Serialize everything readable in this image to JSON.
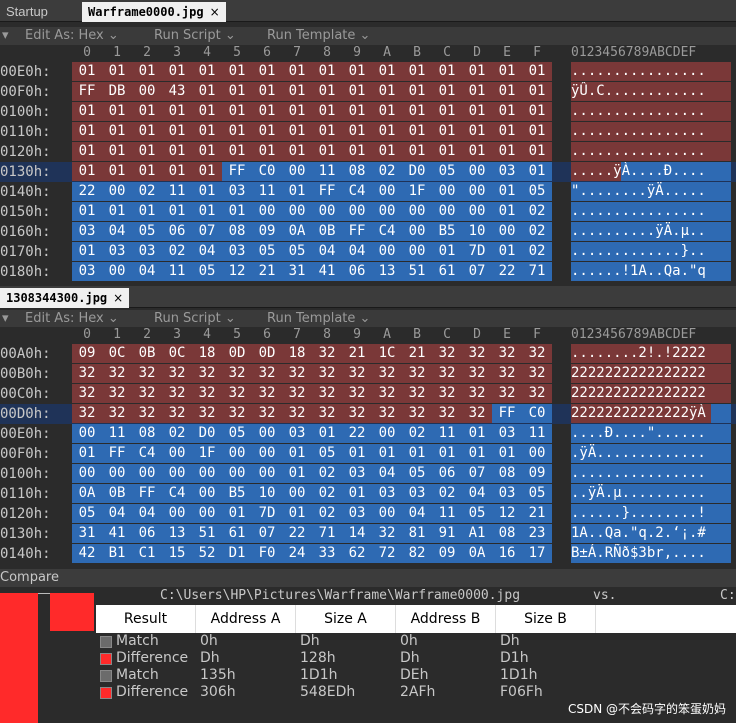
{
  "tabs1": {
    "startup": "Startup",
    "active": "Warframe0000.jpg",
    "close": "×"
  },
  "tabs2": {
    "active": "1308344300.jpg",
    "close": "×"
  },
  "toolbar": {
    "edit_as": "Edit As: Hex",
    "run_script": "Run Script",
    "run_template": "Run Template",
    "chevron": "⌄",
    "triangle": "▾"
  },
  "col_headers": [
    "0",
    "1",
    "2",
    "3",
    "4",
    "5",
    "6",
    "7",
    "8",
    "9",
    "A",
    "B",
    "C",
    "D",
    "E",
    "F"
  ],
  "ascii_header": "0123456789ABCDEF",
  "pane1": {
    "rows": [
      {
        "addr": "00E0h:",
        "bytes": "01 01 01 01 01 01 01 01 01 01 01 01 01 01 01 01",
        "ascii": "................",
        "marks": "dddddddddddddddd"
      },
      {
        "addr": "00F0h:",
        "bytes": "FF DB 00 43 01 01 01 01 01 01 01 01 01 01 01 01",
        "ascii": "ÿÛ.C............",
        "marks": "dddddddddddddddd"
      },
      {
        "addr": "0100h:",
        "bytes": "01 01 01 01 01 01 01 01 01 01 01 01 01 01 01 01",
        "ascii": "................",
        "marks": "dddddddddddddddd"
      },
      {
        "addr": "0110h:",
        "bytes": "01 01 01 01 01 01 01 01 01 01 01 01 01 01 01 01",
        "ascii": "................",
        "marks": "dddddddddddddddd"
      },
      {
        "addr": "0120h:",
        "bytes": "01 01 01 01 01 01 01 01 01 01 01 01 01 01 01 01",
        "ascii": "................",
        "marks": "dddddddddddddddd"
      },
      {
        "addr": "0130h:",
        "bytes": "01 01 01 01 01 FF C0 00 11 08 02 D0 05 00 03 01",
        "ascii": ".....ÿÀ....Ð....",
        "marks": "dddddmmmmmmmmmmm"
      },
      {
        "addr": "0140h:",
        "bytes": "22 00 02 11 01 03 11 01 FF C4 00 1F 00 00 01 05",
        "ascii": "\"........ÿÄ.....",
        "marks": "mmmmmmmmmmmmmmmm"
      },
      {
        "addr": "0150h:",
        "bytes": "01 01 01 01 01 01 00 00 00 00 00 00 00 00 01 02",
        "ascii": "................",
        "marks": "mmmmmmmmmmmmmmmm"
      },
      {
        "addr": "0160h:",
        "bytes": "03 04 05 06 07 08 09 0A 0B FF C4 00 B5 10 00 02",
        "ascii": "..........ÿÄ.µ..",
        "marks": "mmmmmmmmmmmmmmmm"
      },
      {
        "addr": "0170h:",
        "bytes": "01 03 03 02 04 03 05 05 04 04 00 00 01 7D 01 02",
        "ascii": ".............}..",
        "marks": "mmmmmmmmmmmmmmmm"
      },
      {
        "addr": "0180h:",
        "bytes": "03 00 04 11 05 12 21 31 41 06 13 51 61 07 22 71",
        "ascii": "......!1A..Qa.\"q",
        "marks": "mmmmmmmmmmmmmmmm"
      }
    ]
  },
  "pane2": {
    "rows": [
      {
        "addr": "00A0h:",
        "bytes": "09 0C 0B 0C 18 0D 0D 18 32 21 1C 21 32 32 32 32",
        "ascii": "........2!.!2222",
        "marks": "dddddddddddddddd"
      },
      {
        "addr": "00B0h:",
        "bytes": "32 32 32 32 32 32 32 32 32 32 32 32 32 32 32 32",
        "ascii": "2222222222222222",
        "marks": "dddddddddddddddd"
      },
      {
        "addr": "00C0h:",
        "bytes": "32 32 32 32 32 32 32 32 32 32 32 32 32 32 32 32",
        "ascii": "2222222222222222",
        "marks": "dddddddddddddddd"
      },
      {
        "addr": "00D0h:",
        "bytes": "32 32 32 32 32 32 32 32 32 32 32 32 32 32 FF C0",
        "ascii": "22222222222222ÿÀ",
        "marks": "ddddddddddddddmm"
      },
      {
        "addr": "00E0h:",
        "bytes": "00 11 08 02 D0 05 00 03 01 22 00 02 11 01 03 11",
        "ascii": "....Ð....\"......",
        "marks": "mmmmmmmmmmmmmmmm"
      },
      {
        "addr": "00F0h:",
        "bytes": "01 FF C4 00 1F 00 00 01 05 01 01 01 01 01 01 00",
        "ascii": ".ÿÄ.............",
        "marks": "mmmmmmmmmmmmmmmm"
      },
      {
        "addr": "0100h:",
        "bytes": "00 00 00 00 00 00 00 01 02 03 04 05 06 07 08 09",
        "ascii": "................",
        "marks": "mmmmmmmmmmmmmmmm"
      },
      {
        "addr": "0110h:",
        "bytes": "0A 0B FF C4 00 B5 10 00 02 01 03 03 02 04 03 05",
        "ascii": "..ÿÄ.µ..........",
        "marks": "mmmmmmmmmmmmmmmm"
      },
      {
        "addr": "0120h:",
        "bytes": "05 04 04 00 00 01 7D 01 02 03 00 04 11 05 12 21",
        "ascii": "......}........!",
        "marks": "mmmmmmmmmmmmmmmm"
      },
      {
        "addr": "0130h:",
        "bytes": "31 41 06 13 51 61 07 22 71 14 32 81 91 A1 08 23",
        "ascii": "1A..Qa.\"q.2.‘¡.#",
        "marks": "mmmmmmmmmmmmmmmm"
      },
      {
        "addr": "0140h:",
        "bytes": "42 B1 C1 15 52 D1 F0 24 33 62 72 82 09 0A 16 17",
        "ascii": "B±Á.RÑð$3br,....",
        "marks": "mmmmmmmmmmmmmmmm"
      }
    ]
  },
  "compare": {
    "label": "Compare",
    "file_a": "C:\\Users\\HP\\Pictures\\Warframe\\Warframe0000.jpg",
    "vs": "vs.",
    "file_b": "C:",
    "headers": [
      "Result",
      "Address A",
      "Size A",
      "Address B",
      "Size B"
    ],
    "rows": [
      {
        "result": "Match",
        "addr_a": "0h",
        "size_a": "Dh",
        "addr_b": "0h",
        "size_b": "Dh",
        "color": "#6b6b6b"
      },
      {
        "result": "Difference",
        "addr_a": "Dh",
        "size_a": "128h",
        "addr_b": "Dh",
        "size_b": "D1h",
        "color": "#ff2a2a"
      },
      {
        "result": "Match",
        "addr_a": "135h",
        "size_a": "1D1h",
        "addr_b": "DEh",
        "size_b": "1D1h",
        "color": "#6b6b6b"
      },
      {
        "result": "Difference",
        "addr_a": "306h",
        "size_a": "548EDh",
        "addr_b": "2AFh",
        "size_b": "F06Fh",
        "color": "#ff2a2a"
      }
    ]
  },
  "watermark": "CSDN @不会码字的笨蛋奶妈"
}
